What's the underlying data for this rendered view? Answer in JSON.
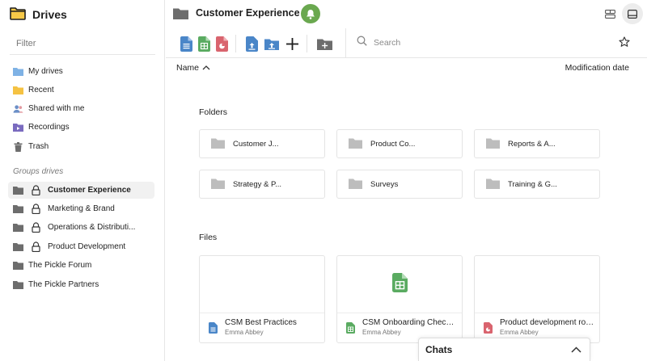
{
  "sidebar": {
    "app_title": "Drives",
    "filter_placeholder": "Filter",
    "items": [
      {
        "label": "My drives",
        "icon": "folder-blue-icon"
      },
      {
        "label": "Recent",
        "icon": "folder-yellow-icon"
      },
      {
        "label": "Shared with me",
        "icon": "people-icon"
      },
      {
        "label": "Recordings",
        "icon": "recordings-icon"
      },
      {
        "label": "Trash",
        "icon": "trash-icon"
      }
    ],
    "groups_label": "Groups drives",
    "groups": [
      {
        "label": "Customer Experience",
        "locked": true,
        "active": true
      },
      {
        "label": "Marketing & Brand",
        "locked": true
      },
      {
        "label": "Operations & Distributi...",
        "locked": true
      },
      {
        "label": "Product Development",
        "locked": true
      },
      {
        "label": "The Pickle Forum",
        "locked": false
      },
      {
        "label": "The Pickle Partners",
        "locked": false
      }
    ]
  },
  "header": {
    "title": "Customer Experience"
  },
  "toolbar": {
    "search_placeholder": "Search"
  },
  "columns": {
    "name": "Name",
    "date": "Modification date"
  },
  "folders": {
    "title": "Folders",
    "items": [
      {
        "name": "Customer J..."
      },
      {
        "name": "Product Co..."
      },
      {
        "name": "Reports & A..."
      },
      {
        "name": "Strategy & P..."
      },
      {
        "name": "Surveys"
      },
      {
        "name": "Training & G..."
      }
    ]
  },
  "files": {
    "title": "Files",
    "items": [
      {
        "name": "CSM Best Practices",
        "owner": "Emma Abbey",
        "type": "doc"
      },
      {
        "name": "CSM Onboarding Checklist",
        "owner": "Emma Abbey",
        "type": "sheet"
      },
      {
        "name": "Product development roadmap",
        "owner": "Emma Abbey",
        "type": "slides"
      }
    ]
  },
  "chats": {
    "label": "Chats"
  },
  "colors": {
    "doc": "#4a86c8",
    "sheet": "#5aab61",
    "slides": "#d9646e",
    "folder": "#bdbdbd",
    "accent_green": "#6aa84f"
  }
}
